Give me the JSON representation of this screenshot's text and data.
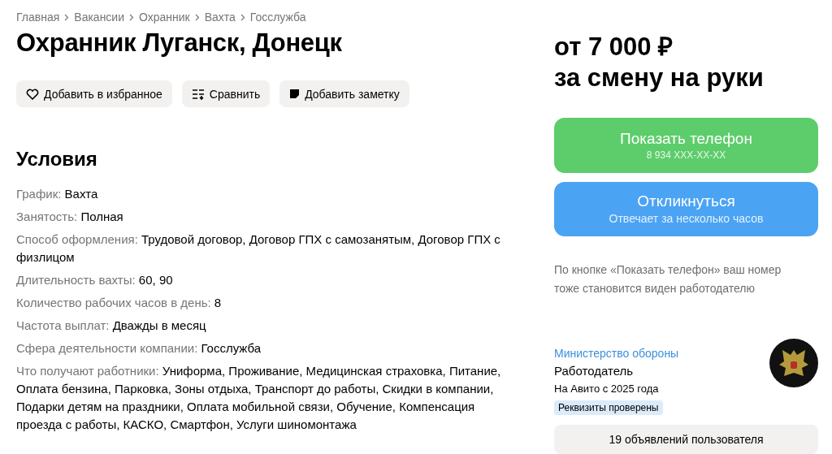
{
  "breadcrumbs": [
    "Главная",
    "Вакансии",
    "Охранник",
    "Вахта",
    "Госслужба"
  ],
  "title": "Охранник Луганск, Донецк",
  "actions": [
    {
      "kind": "favorite",
      "label": "Добавить в избранное"
    },
    {
      "kind": "compare",
      "label": "Сравнить"
    },
    {
      "kind": "note",
      "label": "Добавить заметку"
    }
  ],
  "conditions": {
    "heading": "Условия",
    "rows": [
      {
        "label": "График:",
        "value": "Вахта"
      },
      {
        "label": "Занятость:",
        "value": "Полная"
      },
      {
        "label": "Способ оформления:",
        "value": "Трудовой договор, Договор ГПХ с самозанятым, Договор ГПХ с физлицом"
      },
      {
        "label": "Длительность вахты:",
        "value": "60, 90"
      },
      {
        "label": "Количество рабочих часов в день:",
        "value": "8"
      },
      {
        "label": "Частота выплат:",
        "value": "Дважды в месяц"
      },
      {
        "label": "Сфера деятельности компании:",
        "value": "Госслужба"
      },
      {
        "label": "Что получают работники:",
        "value": "Униформа, Проживание, Медицинская страховка, Питание, Оплата бензина, Парковка, Зоны отдыха, Транспорт до работы, Скидки в компании, Подарки детям на праздники, Оплата мобильной связи, Обучение, Компенсация проезда с работы, КАСКО, Смартфон, Услуги шиномонтажа"
      }
    ]
  },
  "price": {
    "amount": "от 7 000 ₽",
    "unit": "за смену на руки"
  },
  "phone_button": {
    "label": "Показать телефон",
    "sub": "8 934 XXX-XX-XX"
  },
  "respond_button": {
    "label": "Откликнуться",
    "sub": "Отвечает за несколько часов"
  },
  "phone_note": "По кнопке «Показать телефон» ваш номер тоже становится виден работодателю",
  "seller": {
    "name": "Министерство обороны",
    "role": "Работодатель",
    "since": "На Авито с 2025 года",
    "badge": "Реквизиты проверены"
  },
  "listings_button": "19 объявлений пользователя"
}
